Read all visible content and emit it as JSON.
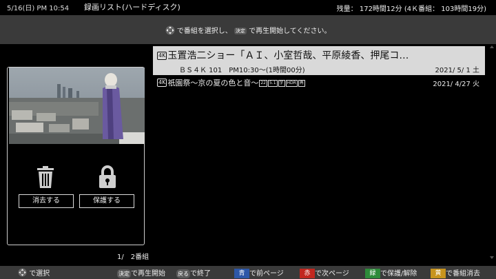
{
  "header": {
    "datetime": "5/16(日) PM 10:54",
    "title": "録画リスト(ハードディスク)",
    "remaining": "残量： 172時間12分 (4Ｋ番組： 103時間19分)"
  },
  "guide": {
    "part1": "で番組を選択し、",
    "key": "決定",
    "part2": "で再生開始してください。"
  },
  "actions": {
    "delete_label": "消去する",
    "protect_label": "保護する"
  },
  "recordings": [
    {
      "badge": "4K",
      "title": "玉置浩二ショー「ＡＩ、小室哲哉、平原綾香、押尾コ…",
      "channel": "ＢＳ４Ｋ 101　PM10:30～(1時間00分)",
      "date": "2021/ 5/ 1 土",
      "selected": true
    },
    {
      "badge": "4K",
      "title": "祇園祭～京の夏の色と音～",
      "marks": [
        "22",
        "5.1",
        "字",
        "HDR",
        "再"
      ],
      "date": "2021/ 4/27 火",
      "selected": false
    }
  ],
  "footer": {
    "count": "1/　2番組",
    "select": "で選択",
    "play_key": "決定",
    "play": "で再生開始",
    "back_key": "戻る",
    "back": "で終了",
    "blue_key": "青",
    "blue": "で前ページ",
    "red_key": "赤",
    "red": "で次ページ",
    "green_key": "緑",
    "green": "で保護/解除",
    "yellow_key": "黄",
    "yellow": "で番組消去"
  },
  "colors": {
    "blue": "#2d57a8",
    "red": "#c2271f",
    "green": "#2e8b3a",
    "yellow": "#c8941e"
  }
}
